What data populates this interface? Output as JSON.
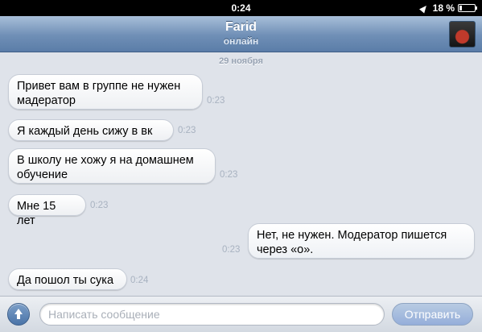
{
  "status_bar": {
    "time": "0:24",
    "battery": "18 %"
  },
  "header": {
    "contact_name": "Farid",
    "contact_status": "онлайн"
  },
  "chat": {
    "date": "29 ноября",
    "messages": [
      {
        "direction": "in",
        "lines": [
          "Привет вам в группе не нужен",
          "мадератор"
        ],
        "time": "0:23"
      },
      {
        "direction": "in",
        "lines": [
          "Я каждый день сижу в вк"
        ],
        "time": "0:23"
      },
      {
        "direction": "in",
        "lines": [
          "В школу не хожу я на домашнем",
          "обучение"
        ],
        "time": "0:23"
      },
      {
        "direction": "in",
        "lines": [
          "Мне 15 лет"
        ],
        "time": "0:23"
      },
      {
        "direction": "out",
        "lines": [
          "Нет, не нужен. Модератор пишется",
          "через «о»."
        ],
        "time": "0:23"
      },
      {
        "direction": "in",
        "lines": [
          "Да пошол ты сука"
        ],
        "time": "0:24"
      }
    ]
  },
  "composer": {
    "placeholder": "Написать сообщение",
    "send_label": "Отправить"
  },
  "icons": {
    "location": "location-arrow-icon",
    "battery": "battery-icon",
    "attach": "attach-arrow-icon"
  }
}
